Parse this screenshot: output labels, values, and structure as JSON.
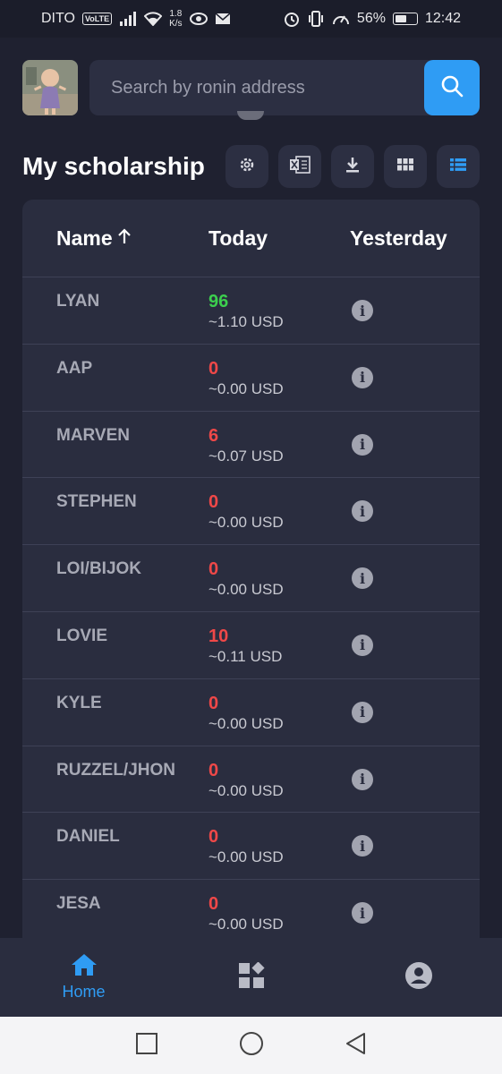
{
  "status_bar": {
    "carrier": "DITO",
    "volte": "VoLTE",
    "net_speed_value": "1.8",
    "net_speed_unit": "K/s",
    "battery": "56%",
    "battery_level": 0.56,
    "time": "12:42"
  },
  "search": {
    "placeholder": "Search by ronin address"
  },
  "page": {
    "title": "My scholarship"
  },
  "toolbar": {
    "icons": [
      "gear-icon",
      "excel-export-icon",
      "download-icon",
      "grid-view-icon",
      "list-view-icon"
    ]
  },
  "table": {
    "headers": {
      "name": "Name",
      "today": "Today",
      "yesterday": "Yesterday"
    },
    "rows": [
      {
        "name": "LYAN",
        "today": "96",
        "usd": "~1.10 USD",
        "status_color": "#3ccf4e"
      },
      {
        "name": "AAP",
        "today": "0",
        "usd": "~0.00 USD",
        "status_color": "#ef4848"
      },
      {
        "name": "MARVEN",
        "today": "6",
        "usd": "~0.07 USD",
        "status_color": "#ef4848"
      },
      {
        "name": "STEPHEN",
        "today": "0",
        "usd": "~0.00 USD",
        "status_color": "#ef4848"
      },
      {
        "name": "LOI/BIJOK",
        "today": "0",
        "usd": "~0.00 USD",
        "status_color": "#ef4848"
      },
      {
        "name": "LOVIE",
        "today": "10",
        "usd": "~0.11 USD",
        "status_color": "#ef4848"
      },
      {
        "name": "KYLE",
        "today": "0",
        "usd": "~0.00 USD",
        "status_color": "#ef4848"
      },
      {
        "name": "RUZZEL/JHON",
        "today": "0",
        "usd": "~0.00 USD",
        "status_color": "#ef4848"
      },
      {
        "name": "DANIEL",
        "today": "0",
        "usd": "~0.00 USD",
        "status_color": "#ef4848"
      },
      {
        "name": "JESA",
        "today": "0",
        "usd": "~0.00 USD",
        "status_color": "#ef4848"
      }
    ]
  },
  "bottom_nav": {
    "home_label": "Home",
    "accent": "#2f9cf4"
  }
}
